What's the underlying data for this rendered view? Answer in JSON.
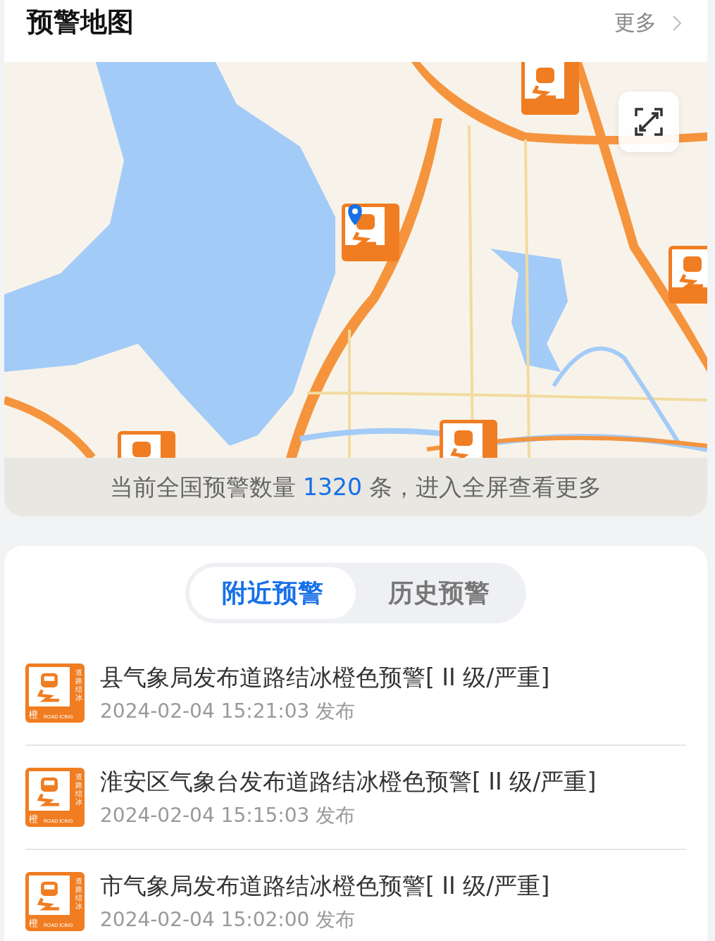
{
  "map_card": {
    "title": "预警地图",
    "more_link": "更多",
    "summary": {
      "prefix": "当前全国预警数量 ",
      "count": "1320",
      "suffix": " 条，进入全屏查看更多"
    }
  },
  "tabs": [
    {
      "label": "附近预警",
      "selected": true
    },
    {
      "label": "历史预警",
      "selected": false
    }
  ],
  "warnings": [
    {
      "title": "县气象局发布道路结冰橙色预警[ II 级/严重]",
      "time": "2024-02-04 15:21:03 发布",
      "badge": {
        "vertical": "道路结冰",
        "level": "橙",
        "english": "ROAD ICING"
      }
    },
    {
      "title": "淮安区气象台发布道路结冰橙色预警[ II 级/严重]",
      "time": "2024-02-04 15:15:03 发布",
      "badge": {
        "vertical": "道路结冰",
        "level": "橙",
        "english": "ROAD ICING"
      }
    },
    {
      "title": "市气象局发布道路结冰橙色预警[ II 级/严重]",
      "time": "2024-02-04 15:02:00 发布",
      "badge": {
        "vertical": "道路结冰",
        "level": "橙",
        "english": "ROAD ICING"
      }
    }
  ]
}
